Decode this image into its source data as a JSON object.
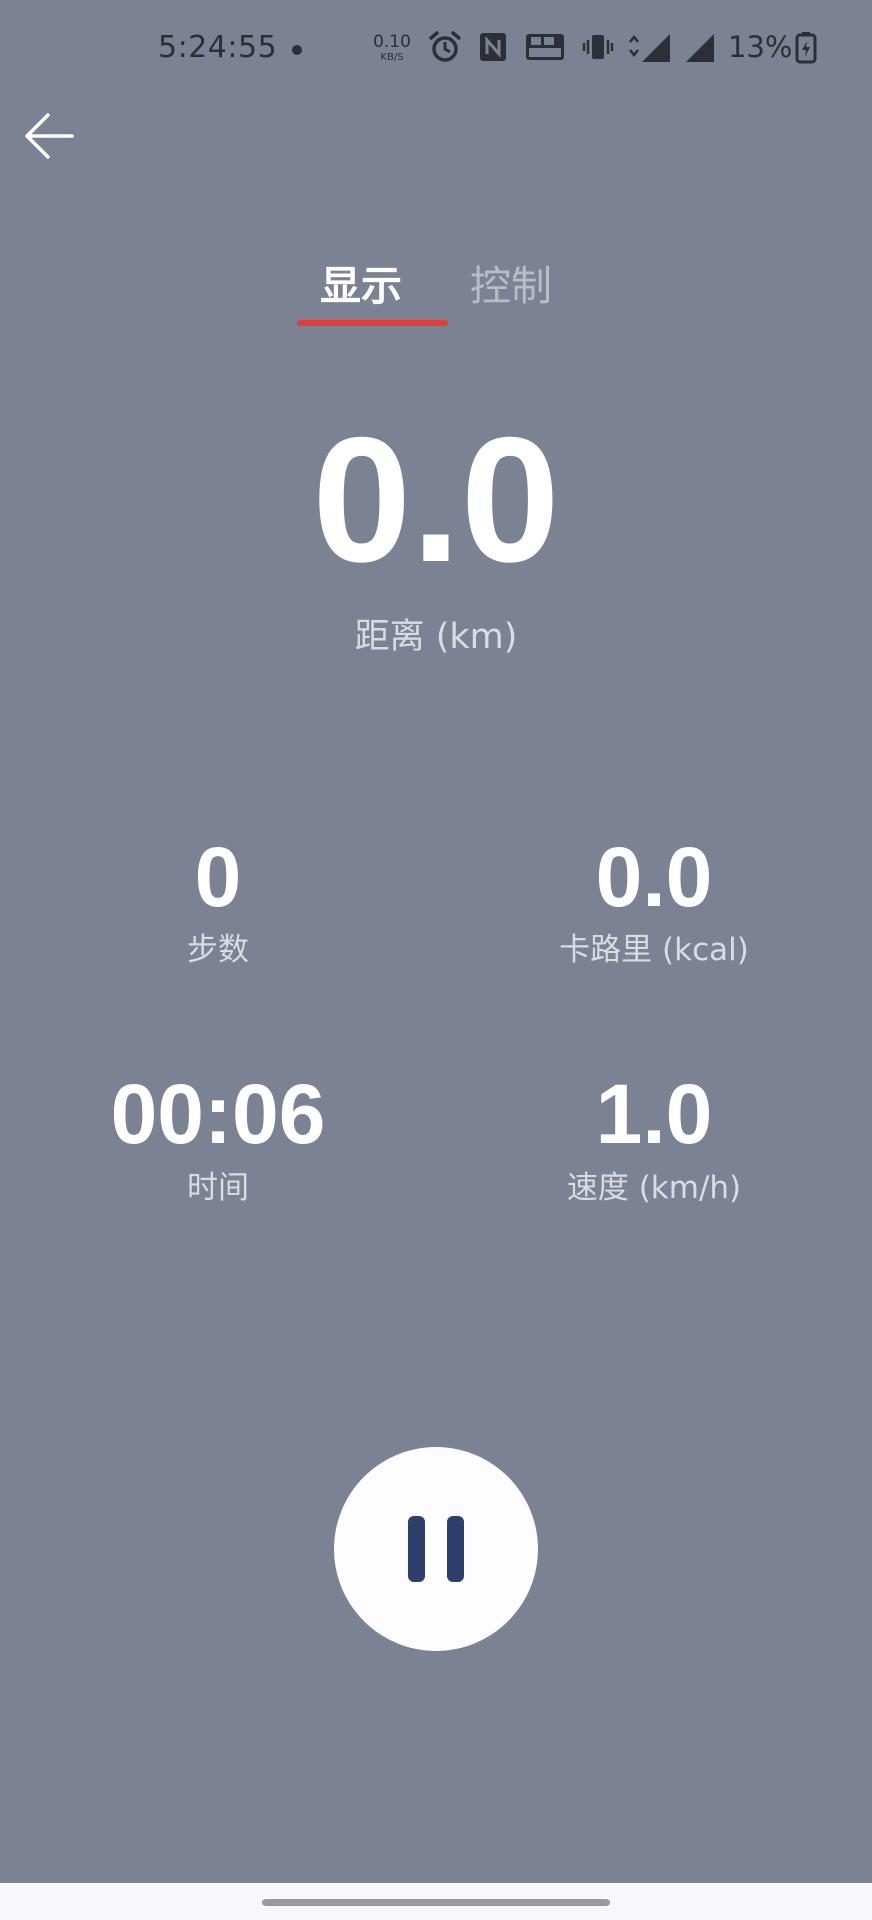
{
  "status_bar": {
    "time": "5:24:55",
    "net_speed_value": "0.10",
    "net_speed_unit": "KB/S",
    "battery": "13%",
    "icons": [
      "alarm-icon",
      "nfc-icon",
      "volte-icon",
      "vibrate-icon",
      "signal-4g-icon",
      "signal-4g-icon",
      "battery-icon"
    ]
  },
  "header": {
    "back_icon": "arrow-left-icon"
  },
  "tabs": [
    {
      "label": "显示",
      "active": true
    },
    {
      "label": "控制",
      "active": false
    }
  ],
  "distance": {
    "value": "0.0",
    "label": "距离 (km)"
  },
  "stats": {
    "steps": {
      "value": "0",
      "label": "步数"
    },
    "calories": {
      "value": "0.0",
      "label": "卡路里 (kcal)"
    },
    "time": {
      "value": "00:06",
      "label": "时间"
    },
    "speed": {
      "value": "1.0",
      "label": "速度 (km/h)"
    }
  },
  "controls": {
    "pause_icon": "pause-icon"
  },
  "colors": {
    "background": "#7a8294",
    "tab_indicator": "#e23c3c",
    "pause_icon": "#2d3e6b"
  }
}
